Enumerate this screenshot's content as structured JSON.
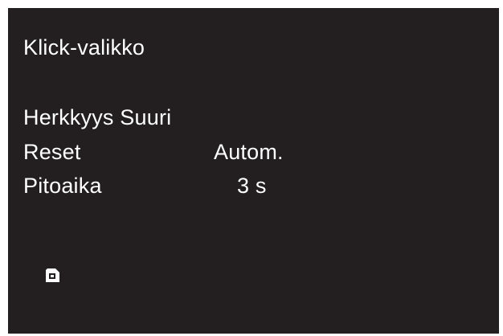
{
  "menu": {
    "title": "Klick-valikko",
    "sensitivity": "Herkkyys Suuri",
    "reset": {
      "label": "Reset",
      "value": "Autom."
    },
    "hold_time": {
      "label": "Pitoaika",
      "value": "3 s"
    }
  },
  "icons": {
    "bottom_left": "save-icon"
  },
  "colors": {
    "background": "#231f20",
    "text": "#ffffff"
  }
}
